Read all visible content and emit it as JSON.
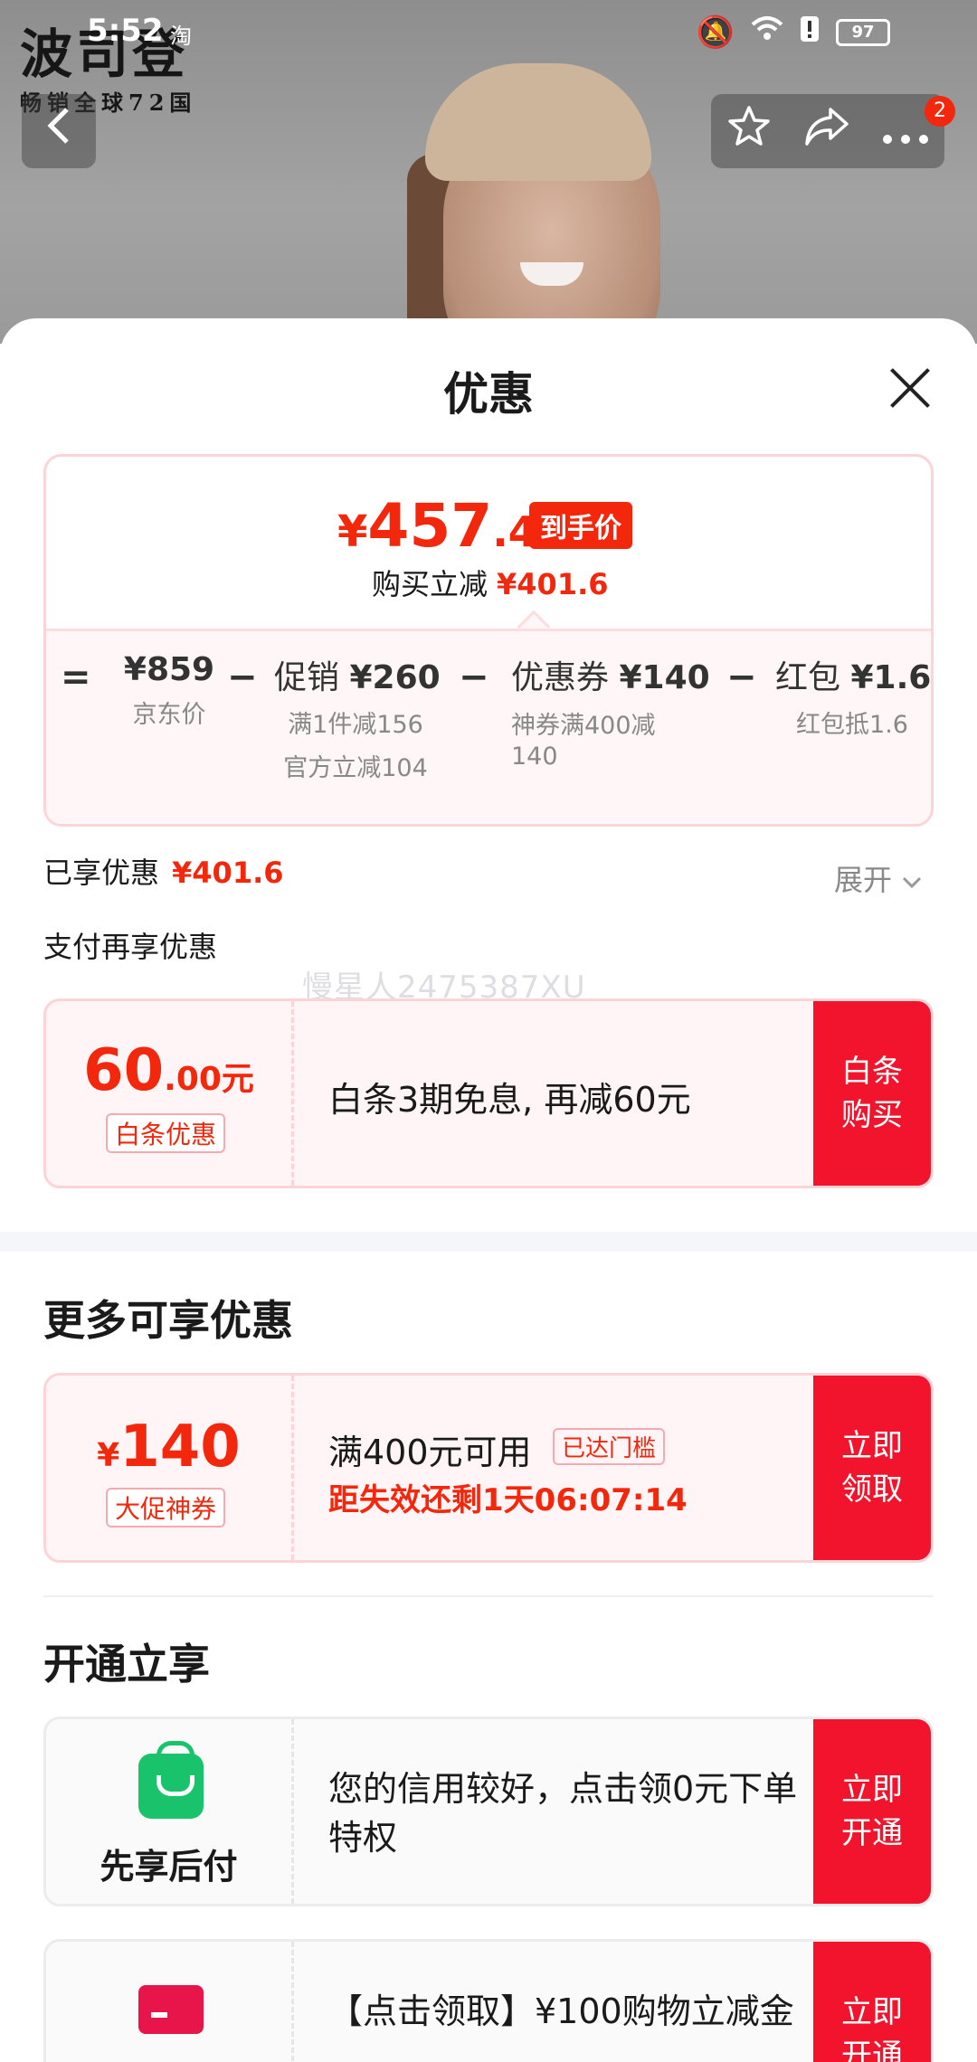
{
  "status_bar": {
    "time": "5:52",
    "app_icon": "淘",
    "battery": "97"
  },
  "hero": {
    "brand_name": "波司登",
    "brand_tagline": "畅销全球72国"
  },
  "nav": {
    "notification_count": "2"
  },
  "sheet": {
    "title": "优惠"
  },
  "price_card": {
    "currency": "¥",
    "final_int": "457",
    "final_dec": ".4",
    "final_tag": "到手价",
    "reduce_label": "购买立减",
    "reduce_amount": "¥401.6",
    "breakdown": [
      {
        "label": "",
        "value": "¥859",
        "sub": [
          "京东价"
        ]
      },
      {
        "label": "促销",
        "value": "¥260",
        "sub": [
          "满1件减156",
          "官方立减104"
        ]
      },
      {
        "label": "优惠券",
        "value": "¥140",
        "sub": [
          "神券满400减",
          "140"
        ]
      },
      {
        "label": "红包",
        "value": "¥1.6",
        "sub": [
          "红包抵1.6"
        ]
      }
    ],
    "operators": [
      "=",
      "−",
      "−",
      "−"
    ]
  },
  "enjoyed": {
    "label": "已享优惠",
    "amount": "¥401.6",
    "expand_label": "展开"
  },
  "pay_more": {
    "title": "支付再享优惠",
    "watermark": "慢星人2475387XU"
  },
  "baitiao_coupon": {
    "amount_int": "60",
    "amount_suffix": ".00元",
    "tag": "白条优惠",
    "desc": "白条3期免息, 再减60元",
    "cta": "白条\n购买"
  },
  "more_section": {
    "title": "更多可享优惠",
    "coupon": {
      "currency": "¥",
      "amount": "140",
      "tag": "大促神券",
      "condition": "满400元可用",
      "reached": "已达门槛",
      "expiry": "距失效还剩1天06:07:14",
      "cta": "立即\n领取"
    }
  },
  "open_section": {
    "title": "开通立享",
    "items": [
      {
        "name": "先享后付",
        "desc": "您的信用较好，点击领0元下单特权",
        "cta": "立即\n开通"
      },
      {
        "name": "",
        "desc": "【点击领取】¥100购物立减金",
        "cta": "立即\n开通"
      }
    ]
  },
  "colors": {
    "accent_red": "#f2270c",
    "cta_red": "#f2142c",
    "card_border": "#fcd4d8",
    "bnpl_green": "#19c36b"
  }
}
